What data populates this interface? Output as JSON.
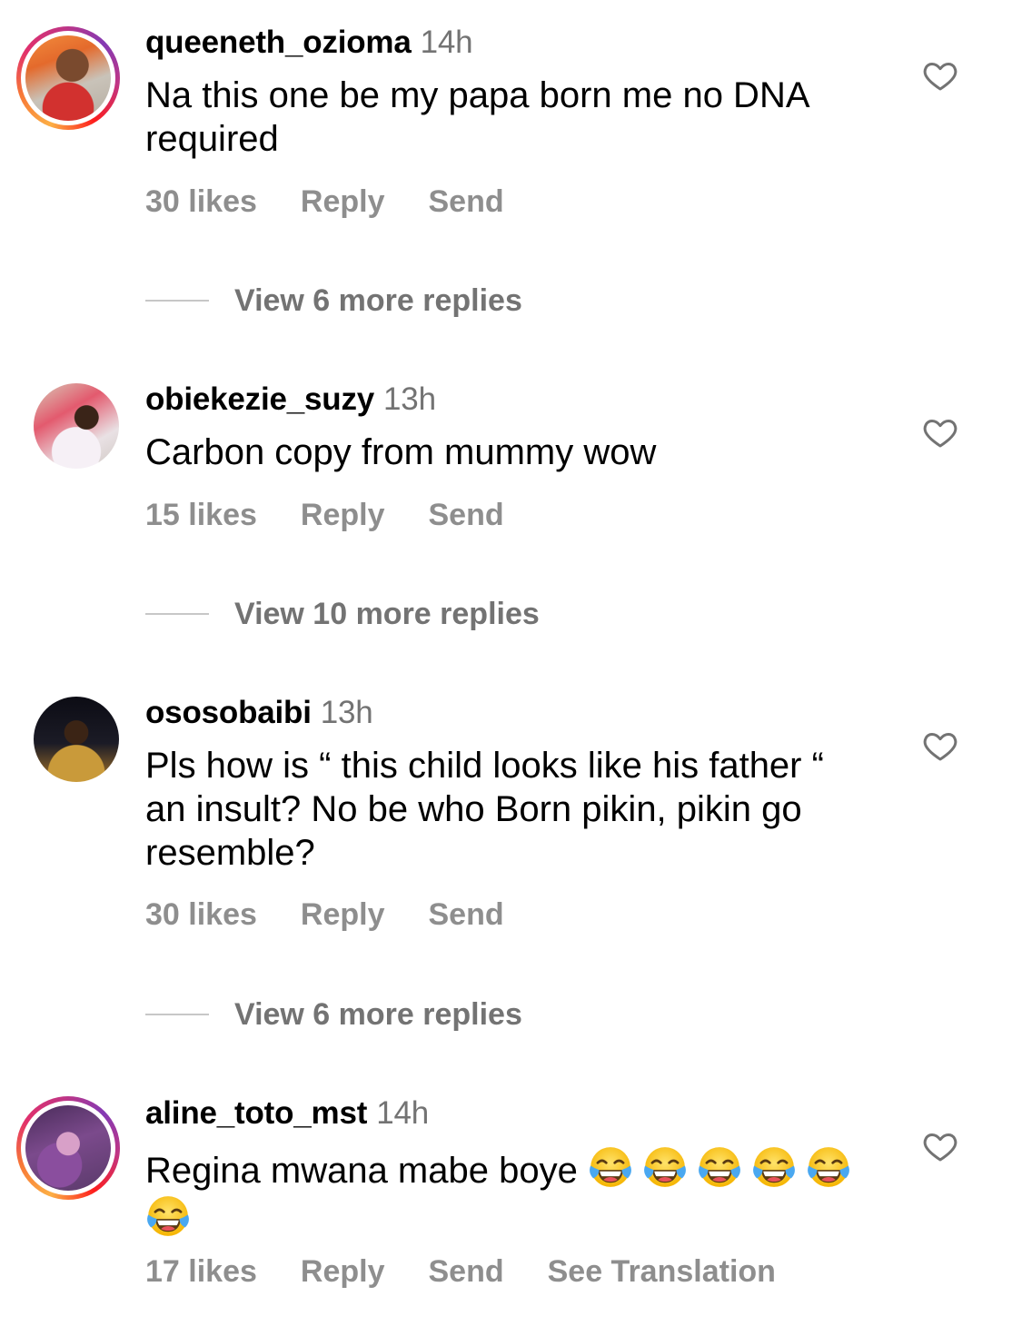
{
  "comments": [
    {
      "username": "queeneth_ozioma",
      "time": "14h",
      "text": "Na this one be my papa born me no DNA required",
      "likes": "30 likes",
      "reply": "Reply",
      "send": "Send",
      "view_replies": "View 6 more replies",
      "avatar_ring": true
    },
    {
      "username": "obiekezie_suzy",
      "time": "13h",
      "text": "Carbon copy from mummy wow",
      "likes": "15 likes",
      "reply": "Reply",
      "send": "Send",
      "view_replies": "View 10 more replies",
      "avatar_ring": false
    },
    {
      "username": "ososobaibi",
      "time": "13h",
      "text": "Pls how is “ this child looks like his father “ an insult? No be who Born pikin, pikin go resemble?",
      "likes": "30 likes",
      "reply": "Reply",
      "send": "Send",
      "view_replies": "View 6 more replies",
      "avatar_ring": false
    },
    {
      "username": "aline_toto_mst",
      "time": "14h",
      "text": "Regina mwana mabe boye",
      "emoji_count": 6,
      "emoji": "face-with-tears-of-joy",
      "likes": "17 likes",
      "reply": "Reply",
      "send": "Send",
      "see_translation": "See Translation",
      "avatar_ring": true
    }
  ],
  "icons": {
    "like": "heart-outline-icon"
  },
  "colors": {
    "primary_text": "#000000",
    "secondary_text": "#737373",
    "action_text": "#8e8e8e",
    "divider": "#c7c7c7",
    "heart_stroke": "#737373"
  }
}
